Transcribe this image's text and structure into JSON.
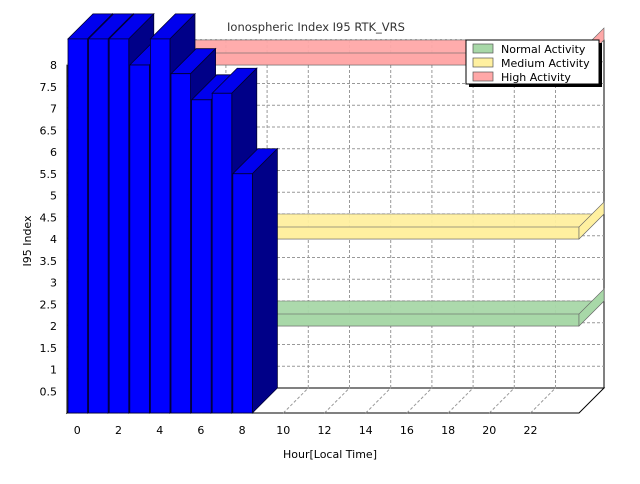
{
  "chart_data": {
    "type": "bar",
    "title": "Ionospheric Index I95 RTK_VRS",
    "xlabel": "Hour[Local Time]",
    "ylabel": "I95 Index",
    "x_tick_labels": [
      "0",
      "2",
      "4",
      "6",
      "8",
      "10",
      "12",
      "14",
      "16",
      "18",
      "20",
      "22"
    ],
    "y_tick_labels": [
      "0.5",
      "1",
      "1.5",
      "2",
      "2.5",
      "3",
      "3.5",
      "4",
      "4.5",
      "5",
      "5.5",
      "6",
      "6.5",
      "7",
      "7.5",
      "8"
    ],
    "xlim": [
      -0.5,
      25
    ],
    "ylim": [
      0,
      8
    ],
    "grid": true,
    "legend_position": "top-right",
    "bars": {
      "x": [
        0,
        1,
        2,
        3,
        4,
        5,
        6,
        7,
        8
      ],
      "values": [
        8.6,
        8.6,
        8.6,
        8.0,
        8.6,
        7.8,
        7.2,
        7.35,
        5.5
      ],
      "color": "#0000ff"
    },
    "bands": [
      {
        "name": "Normal Activity",
        "value": 2,
        "color": "#a8d8a8"
      },
      {
        "name": "Medium Activity",
        "value": 4,
        "color": "#fff0a0"
      },
      {
        "name": "High Activity",
        "value": 8,
        "color": "#ffa8a8"
      }
    ]
  }
}
